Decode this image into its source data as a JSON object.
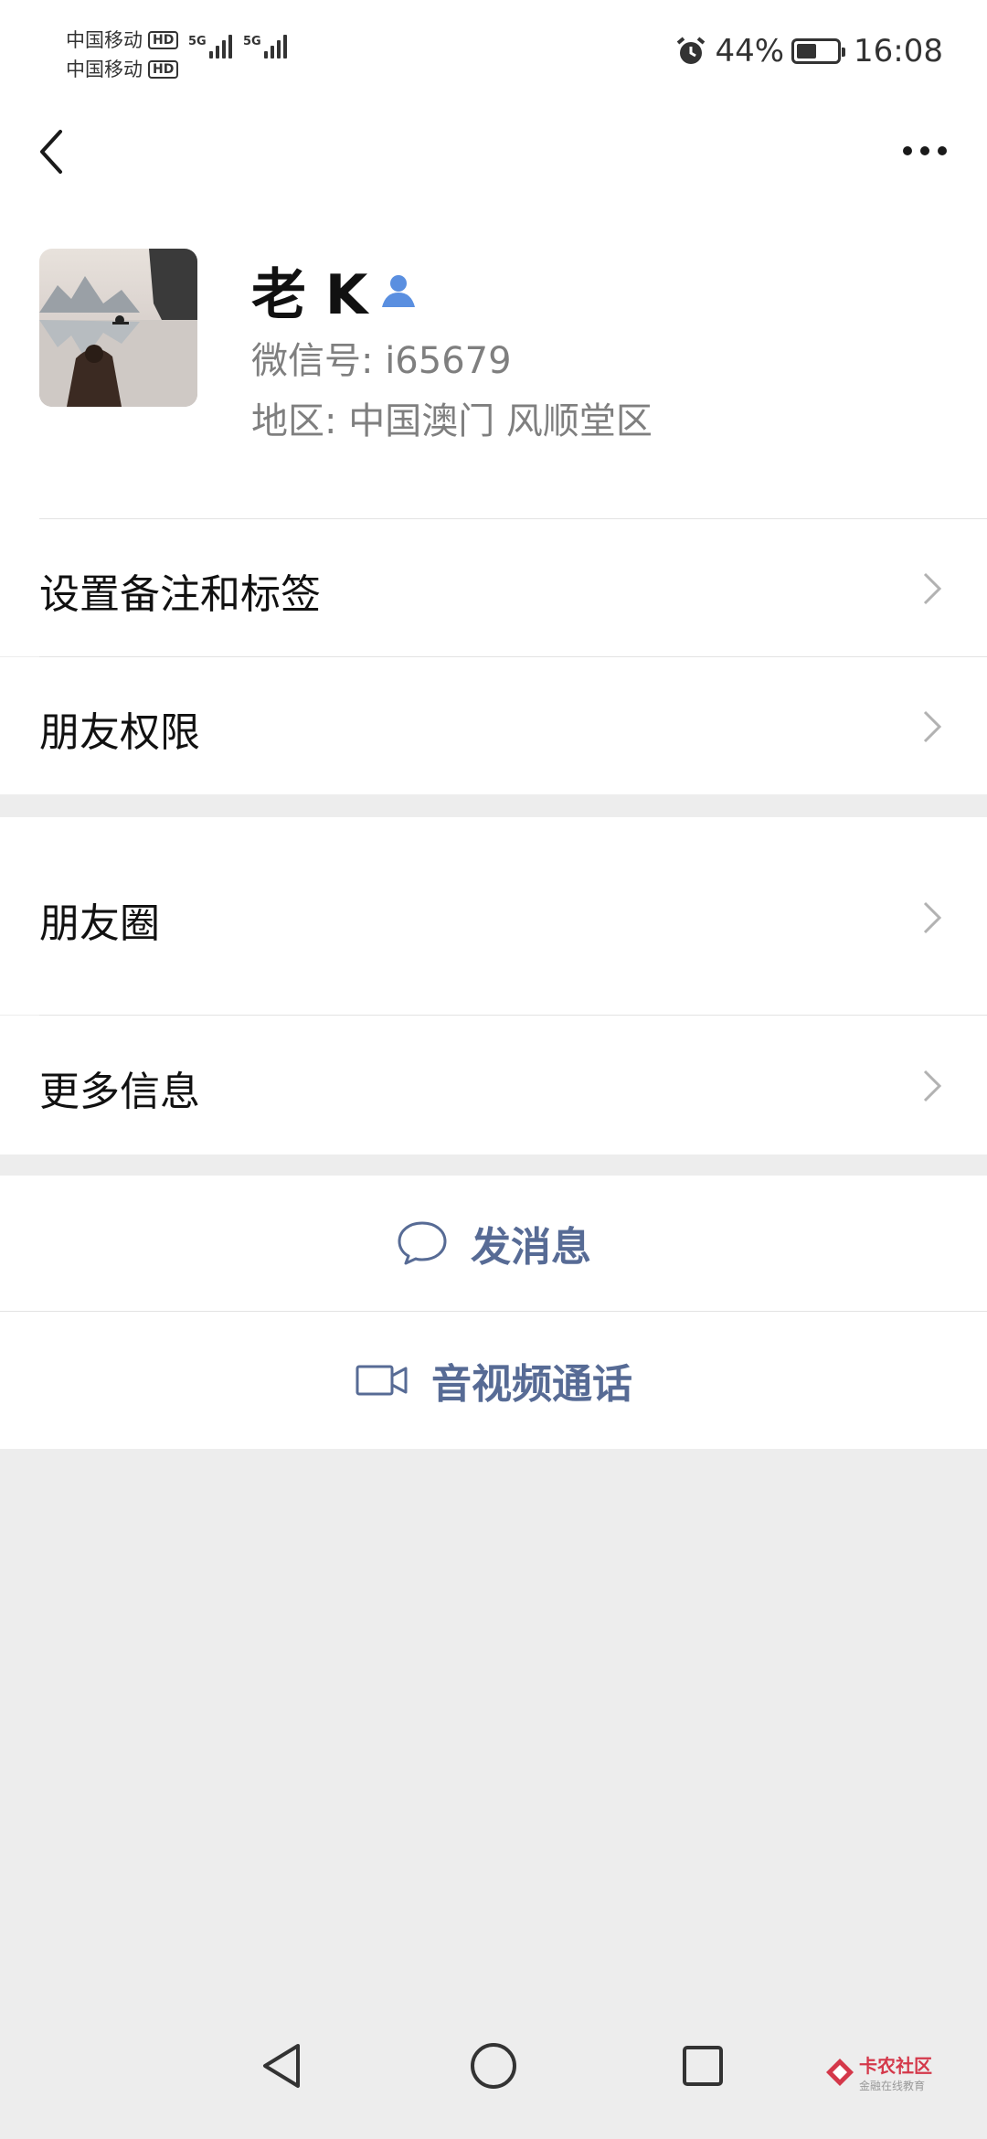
{
  "status_bar": {
    "carrier1": "中国移动",
    "carrier2": "中国移动",
    "hd_badge": "HD",
    "net1": "5G",
    "net2": "5G",
    "battery": "44%",
    "time": "16:08"
  },
  "profile": {
    "name": "老 K",
    "wechat_id": "微信号: i65679",
    "region": "地区: 中国澳门  风顺堂区"
  },
  "menu": [
    {
      "label": "设置备注和标签"
    },
    {
      "label": "朋友权限"
    },
    {
      "label": "朋友圈"
    },
    {
      "label": "更多信息"
    }
  ],
  "actions": {
    "message": "发消息",
    "video_call": "音视频通话"
  },
  "watermark": {
    "title": "卡农社区",
    "subtitle": "金融在线教育"
  },
  "colors": {
    "background": "#ededed",
    "link": "#576b95",
    "badge_blue": "#5a8fe0"
  },
  "icons": [
    "back-arrow-icon",
    "more-dots-icon",
    "contact-badge-icon",
    "chevron-right-icon",
    "chat-bubble-icon",
    "video-camera-icon",
    "nav-back-icon",
    "nav-home-icon",
    "nav-recent-icon"
  ]
}
